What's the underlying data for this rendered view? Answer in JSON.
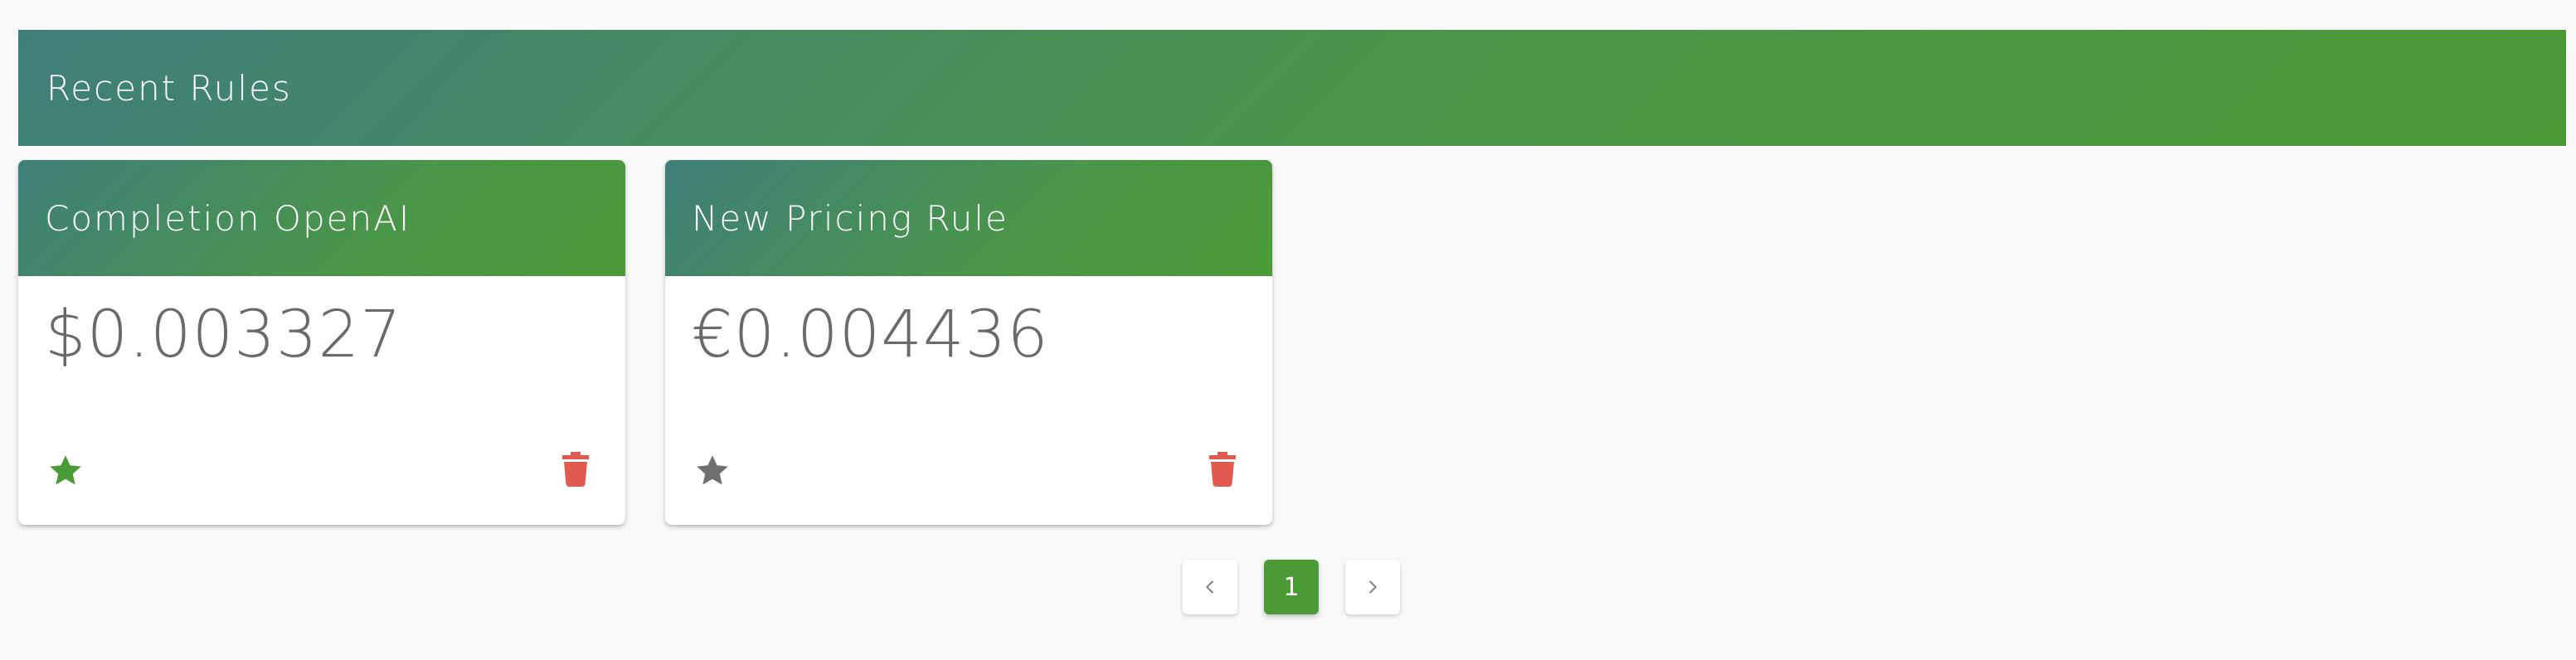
{
  "header": {
    "title": "Recent Rules"
  },
  "cards": [
    {
      "title": "Completion OpenAI",
      "price": "$0.003327",
      "favorite": true
    },
    {
      "title": "New Pricing Rule",
      "price": "€0.004436",
      "favorite": false
    }
  ],
  "pagination": {
    "current_page": "1"
  },
  "colors": {
    "accent_green": "#4a9a36",
    "accent_teal": "#3f7f7a",
    "delete_red": "#e05a4f",
    "star_inactive": "#6f6f6f"
  },
  "icons": {
    "favorite": "star-icon",
    "delete": "trash-icon",
    "prev": "chevron-left-icon",
    "next": "chevron-right-icon"
  }
}
